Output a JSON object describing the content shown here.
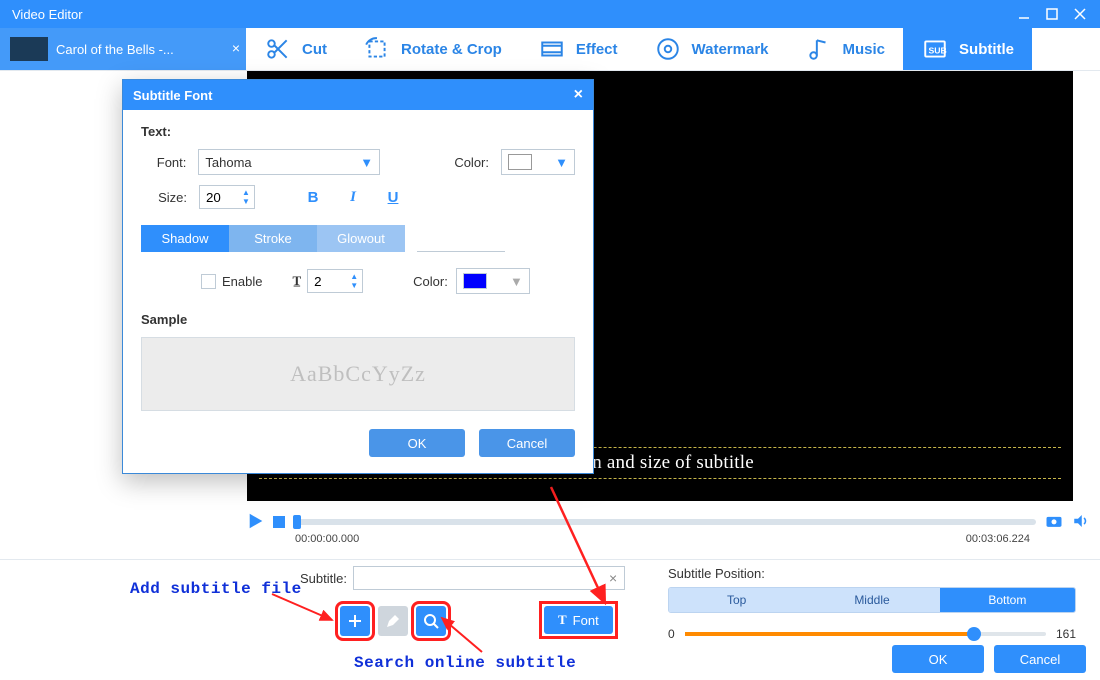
{
  "window": {
    "title": "Video Editor"
  },
  "project_tab": {
    "label": "Carol of the Bells -..."
  },
  "toolbar": {
    "cut": "Cut",
    "rotate": "Rotate & Crop",
    "effect": "Effect",
    "watermark": "Watermark",
    "music": "Music",
    "subtitle": "Subtitle"
  },
  "preview": {
    "caption_visible": "ition and size of subtitle",
    "time_start": "00:00:00.000",
    "time_end": "00:03:06.224"
  },
  "dialog": {
    "title": "Subtitle Font",
    "section_text": "Text:",
    "font_label": "Font:",
    "font_value": "Tahoma",
    "color_label": "Color:",
    "text_color": "#ffffff",
    "size_label": "Size:",
    "size_value": "20",
    "tabs": {
      "shadow": "Shadow",
      "stroke": "Stroke",
      "glowout": "Glowout"
    },
    "enable_label": "Enable",
    "thickness_value": "2",
    "shadow_color_label": "Color:",
    "shadow_color": "#0000ff",
    "sample_label": "Sample",
    "sample_text": "AaBbCcYyZz",
    "ok": "OK",
    "cancel": "Cancel"
  },
  "subtitle_bar": {
    "label": "Subtitle:",
    "value": "",
    "font_btn": "Font"
  },
  "position_panel": {
    "title": "Subtitle Position:",
    "top": "Top",
    "middle": "Middle",
    "bottom": "Bottom",
    "min": "0",
    "max": "161"
  },
  "annotations": {
    "add": "Add subtitle file",
    "search": "Search online subtitle"
  },
  "footer": {
    "ok": "OK",
    "cancel": "Cancel"
  }
}
